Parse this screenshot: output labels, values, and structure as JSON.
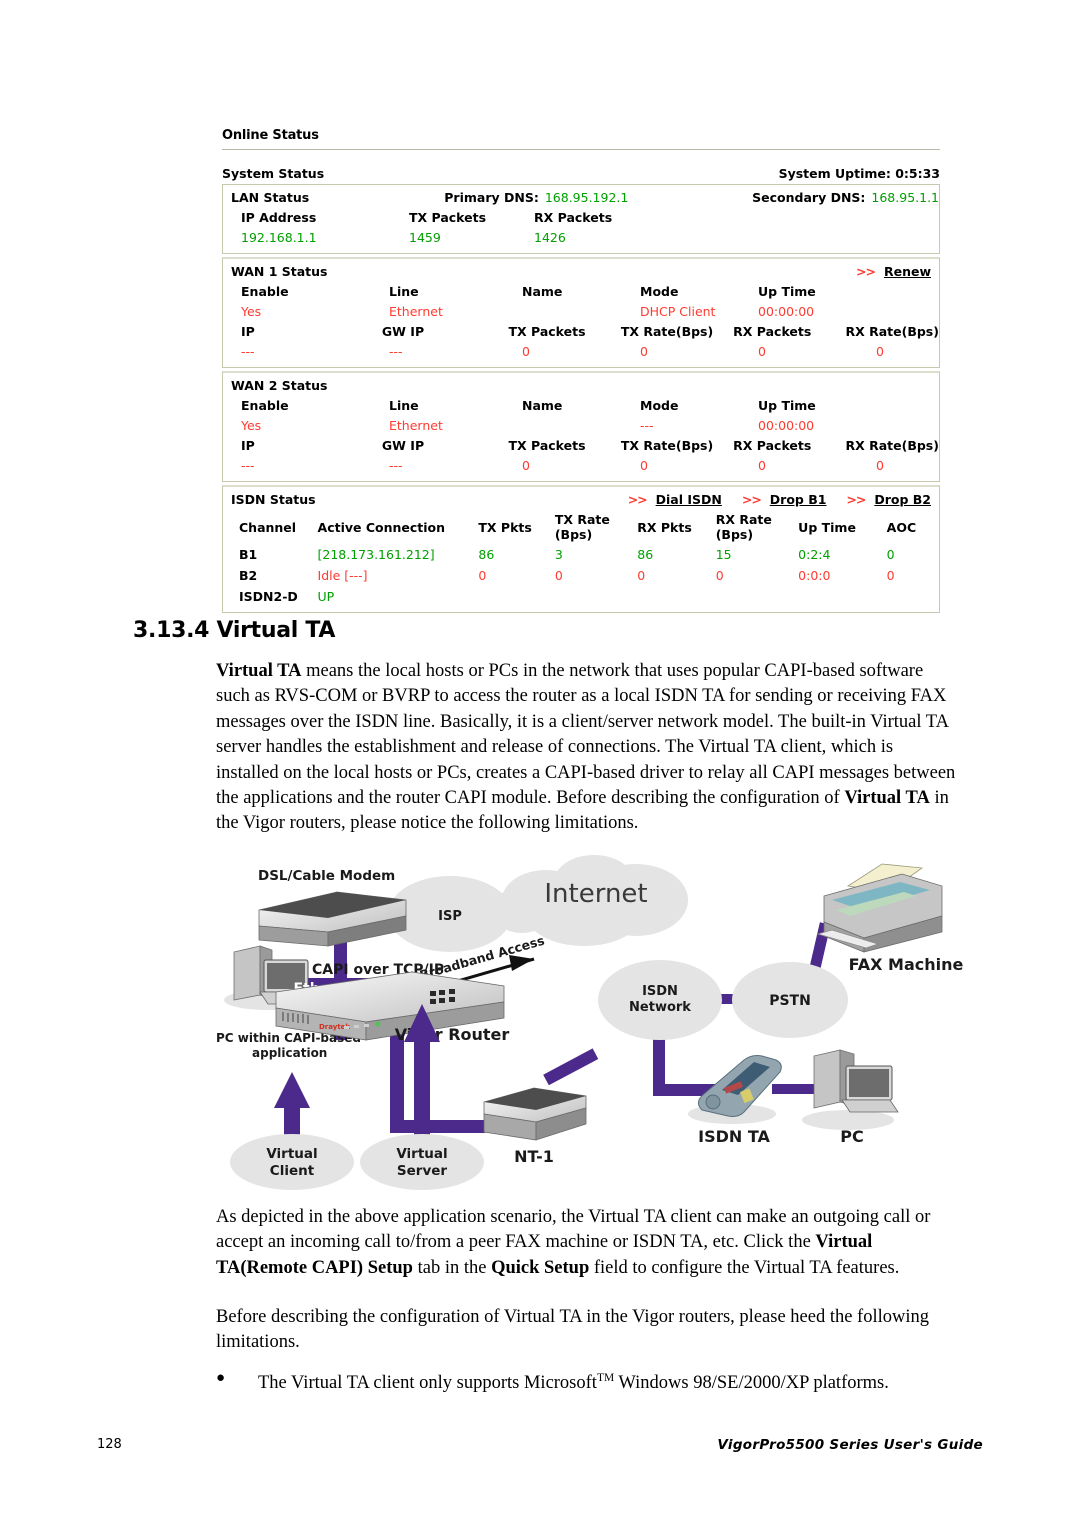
{
  "screenshot": {
    "title": "Online Status",
    "system_status_label": "System Status",
    "system_uptime": "System Uptime: 0:5:33",
    "lan": {
      "section_label": "LAN Status",
      "primary_dns_label": "Primary DNS:",
      "primary_dns_value": "168.95.192.1",
      "secondary_dns_label": "Secondary DNS:",
      "secondary_dns_value": "168.95.1.1",
      "headers": [
        "IP Address",
        "TX Packets",
        "RX Packets"
      ],
      "values": [
        "192.168.1.1",
        "1459",
        "1426"
      ]
    },
    "wan1": {
      "section_label": "WAN 1 Status",
      "link_arrow": ">>",
      "link_label": "Renew",
      "headers_row1": [
        "Enable",
        "Line",
        "Name",
        "Mode",
        "Up Time"
      ],
      "values_row1": [
        "Yes",
        "Ethernet",
        "",
        "DHCP Client",
        "00:00:00"
      ],
      "headers_row2": [
        "IP",
        "GW IP",
        "TX Packets",
        "TX Rate(Bps)",
        "RX Packets",
        "RX Rate(Bps)"
      ],
      "values_row2": [
        "---",
        "---",
        "0",
        "0",
        "0",
        "0"
      ]
    },
    "wan2": {
      "section_label": "WAN 2 Status",
      "headers_row1": [
        "Enable",
        "Line",
        "Name",
        "Mode",
        "Up Time"
      ],
      "values_row1": [
        "Yes",
        "Ethernet",
        "",
        "---",
        "00:00:00"
      ],
      "headers_row2": [
        "IP",
        "GW IP",
        "TX Packets",
        "TX Rate(Bps)",
        "RX Packets",
        "RX Rate(Bps)"
      ],
      "values_row2": [
        "---",
        "---",
        "0",
        "0",
        "0",
        "0"
      ]
    },
    "isdn": {
      "section_label": "ISDN Status",
      "links": [
        {
          "arrow": ">>",
          "label": "Dial ISDN"
        },
        {
          "arrow": ">>",
          "label": "Drop B1"
        },
        {
          "arrow": ">>",
          "label": "Drop B2"
        }
      ],
      "headers": [
        "Channel",
        "Active Connection",
        "TX Pkts",
        "TX Rate (Bps)",
        "RX Pkts",
        "RX Rate (Bps)",
        "Up Time",
        "AOC"
      ],
      "header_tx_rate_l1": "TX Rate",
      "header_tx_rate_l2": "(Bps)",
      "header_rx_rate_l1": "RX Rate",
      "header_rx_rate_l2": "(Bps)",
      "rows": [
        {
          "channel": "B1",
          "conn": "[218.173.161.212]",
          "txpkts": "86",
          "txrate": "3",
          "rxpkts": "86",
          "rxrate": "15",
          "uptime": "0:2:4",
          "aoc": "0"
        },
        {
          "channel": "B2",
          "conn": "Idle [---]",
          "txpkts": "0",
          "txrate": "0",
          "rxpkts": "0",
          "rxrate": "0",
          "uptime": "0:0:0",
          "aoc": "0"
        }
      ],
      "d_channel_label": "ISDN2-D",
      "d_channel_state": "UP"
    },
    "colors": {
      "green": "#00a000",
      "red": "#ff3b30",
      "border": "#c8c8ae"
    }
  },
  "section": {
    "number": "3.13.4",
    "heading": "3.13.4 Virtual TA",
    "title": "Virtual TA"
  },
  "body": {
    "p1_b1": "Virtual TA",
    "p1_rest1": " means the local hosts or PCs in the network that uses popular CAPI-based software such as RVS-COM or BVRP to access the router as a local ISDN TA for sending or receiving FAX messages over the ISDN line. Basically, it is a client/server network model. The built-in Virtual TA server handles the establishment and release of connections. The Virtual TA client, which is installed on the local hosts or PCs, creates a CAPI-based driver to relay all CAPI messages between the applications and the router CAPI module. Before describing the configuration of ",
    "p1_b2": "Virtual TA",
    "p1_rest2": " in the Vigor routers, please notice the following limitations.",
    "p2_a": "As depicted in the above application scenario, the Virtual TA client can make an outgoing call or accept an incoming call to/from a peer FAX machine or ISDN TA, etc. Click the ",
    "p2_b1": "Virtual TA(Remote CAPI) Setup",
    "p2_mid": " tab in the ",
    "p2_b2": "Quick Setup",
    "p2_end": " field to configure the Virtual TA features.",
    "p3": "Before describing the configuration of Virtual TA in the Vigor routers, please heed the following limitations.",
    "bullet_dot": "●",
    "bullet_a": "The Virtual TA client only supports Microsoft",
    "bullet_sup": "TM",
    "bullet_b": " Windows 98/SE/2000/XP platforms."
  },
  "diagram": {
    "labels": {
      "dsl_modem": "DSL/Cable Modem",
      "isp": "ISP",
      "internet": "Internet",
      "broadband": "Normal Broadband Access",
      "capi_tcpip": "CAPI over TCP/IP",
      "ethernet_lan": "Ethernet LAN",
      "pc_capi_l1": "PC within CAPI-based",
      "pc_capi_l2": "application",
      "vigor_router": "Vigor Router",
      "virtual_client_l1": "Virtual",
      "virtual_client_l2": "Client",
      "virtual_server_l1": "Virtual",
      "virtual_server_l2": "Server",
      "nt1": "NT-1",
      "isdn_network_l1": "ISDN",
      "isdn_network_l2": "Network",
      "pstn": "PSTN",
      "fax_machine": "FAX Machine",
      "isdn_ta": "ISDN TA",
      "pc": "PC"
    },
    "colors": {
      "link": "#4b2a8c",
      "cloud": "#e2e2e2",
      "device": "#b8b8b8"
    }
  },
  "footer": {
    "page_number": "128",
    "guide_title": "VigorPro5500 Series User's Guide"
  }
}
